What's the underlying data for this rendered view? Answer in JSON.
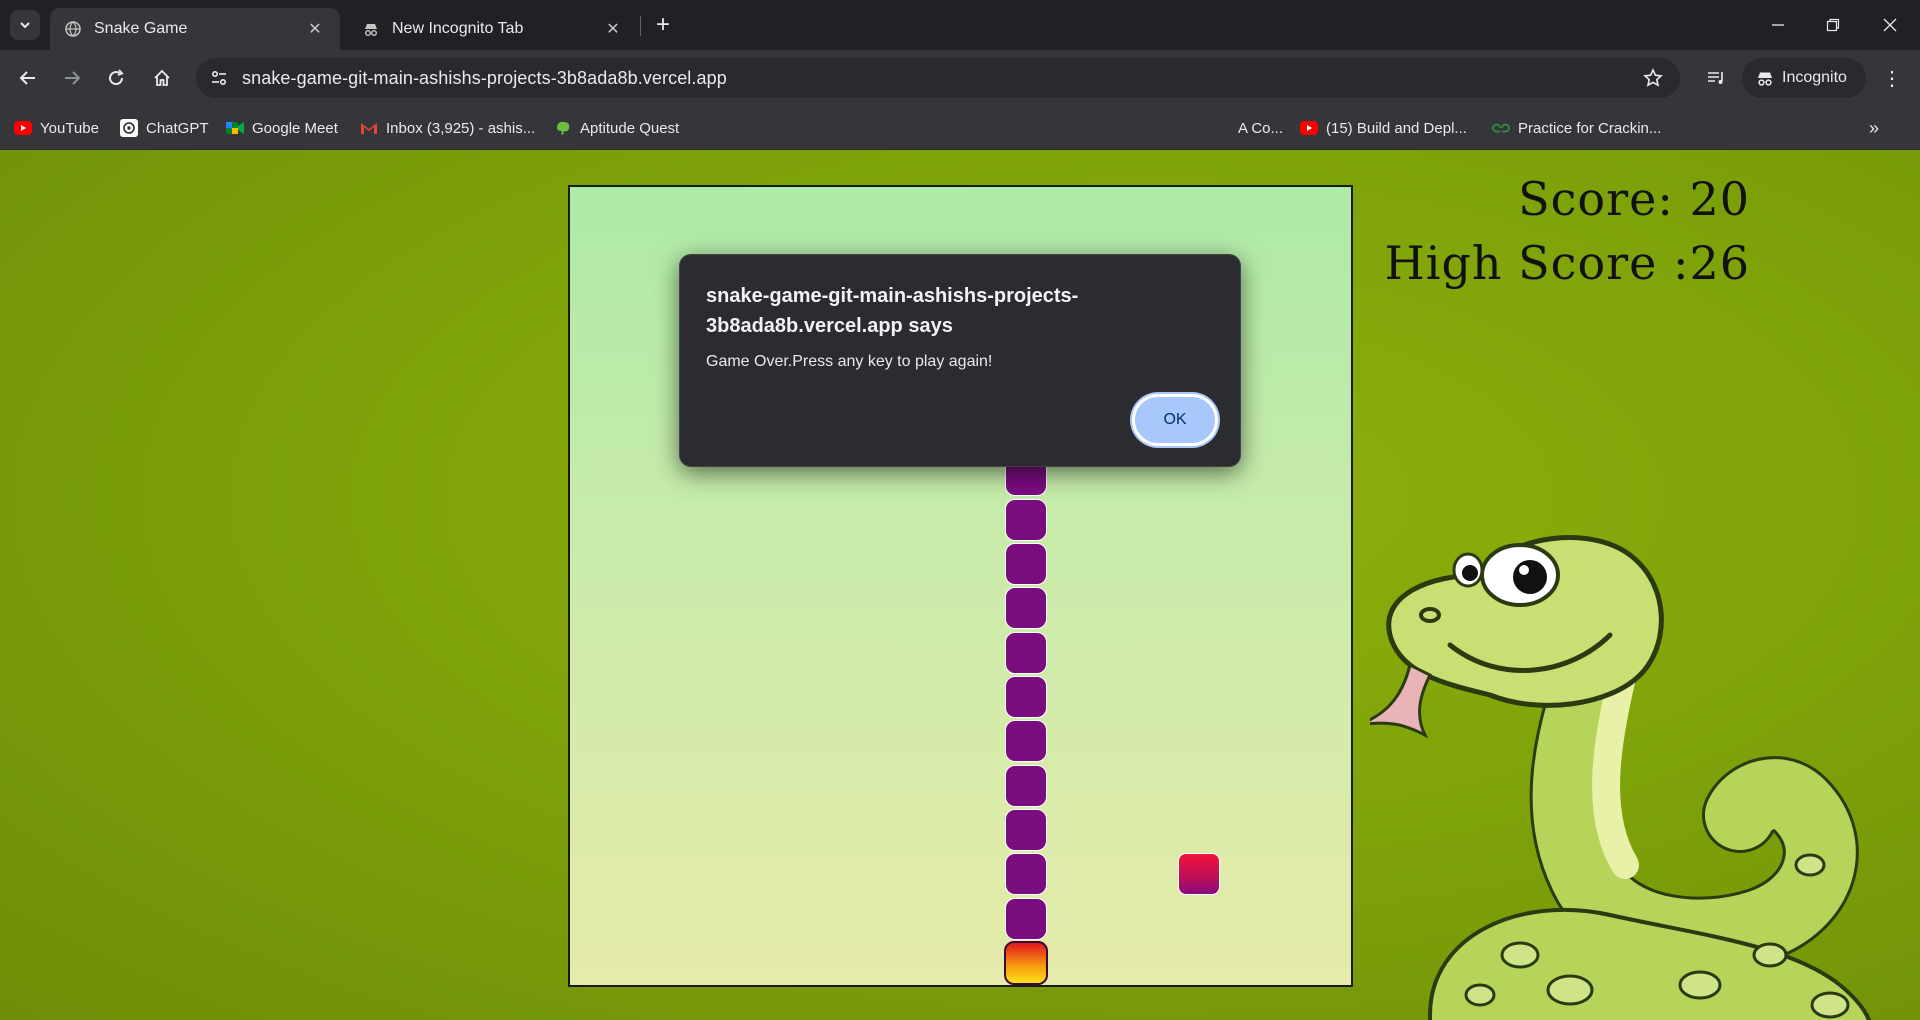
{
  "browser": {
    "tabs": [
      {
        "label": "Snake Game",
        "active": true
      },
      {
        "label": "New Incognito Tab",
        "active": false
      }
    ],
    "url": "snake-game-git-main-ashishs-projects-3b8ada8b.vercel.app",
    "profile_label": "Incognito",
    "bookmarks": [
      {
        "label": "YouTube",
        "icon": "youtube-icon"
      },
      {
        "label": "ChatGPT",
        "icon": "chatgpt-icon"
      },
      {
        "label": "Google Meet",
        "icon": "meet-icon"
      },
      {
        "label": "Inbox (3,925) - ashis...",
        "icon": "gmail-icon"
      },
      {
        "label": "Aptitude Quest",
        "icon": "brain-icon"
      },
      {
        "label": "A Co...",
        "icon": "generic-icon"
      },
      {
        "label": "(15) Build and Depl...",
        "icon": "youtube-icon"
      },
      {
        "label": "Practice for Crackin...",
        "icon": "gfg-icon"
      }
    ]
  },
  "game": {
    "score_text": "Score: 20",
    "high_score_text": "High Score :26",
    "score": 20,
    "high_score": 26,
    "grid": {
      "cols": 18,
      "rows": 18
    },
    "snake_body": [
      [
        4,
        3
      ],
      [
        5,
        3
      ],
      [
        6,
        3
      ],
      [
        7,
        3
      ],
      [
        8,
        3
      ],
      [
        9,
        3
      ],
      [
        10,
        3
      ],
      [
        10,
        4
      ],
      [
        10,
        5
      ],
      [
        10,
        6
      ],
      [
        10,
        7
      ],
      [
        10,
        8
      ],
      [
        10,
        9
      ],
      [
        10,
        10
      ],
      [
        10,
        11
      ],
      [
        10,
        12
      ],
      [
        10,
        13
      ],
      [
        10,
        14
      ],
      [
        10,
        15
      ],
      [
        10,
        16
      ]
    ],
    "snake_head": [
      10,
      17
    ],
    "food": [
      14,
      15
    ],
    "colors": {
      "snake": "#7b0c80",
      "food": "#d3124a",
      "head": "#f7a10d",
      "background": "#7fa30a"
    }
  },
  "dialog": {
    "title": "snake-game-git-main-ashishs-projects-3b8ada8b.vercel.app says",
    "message": "Game Over.Press any key to play again!",
    "ok_label": "OK"
  }
}
